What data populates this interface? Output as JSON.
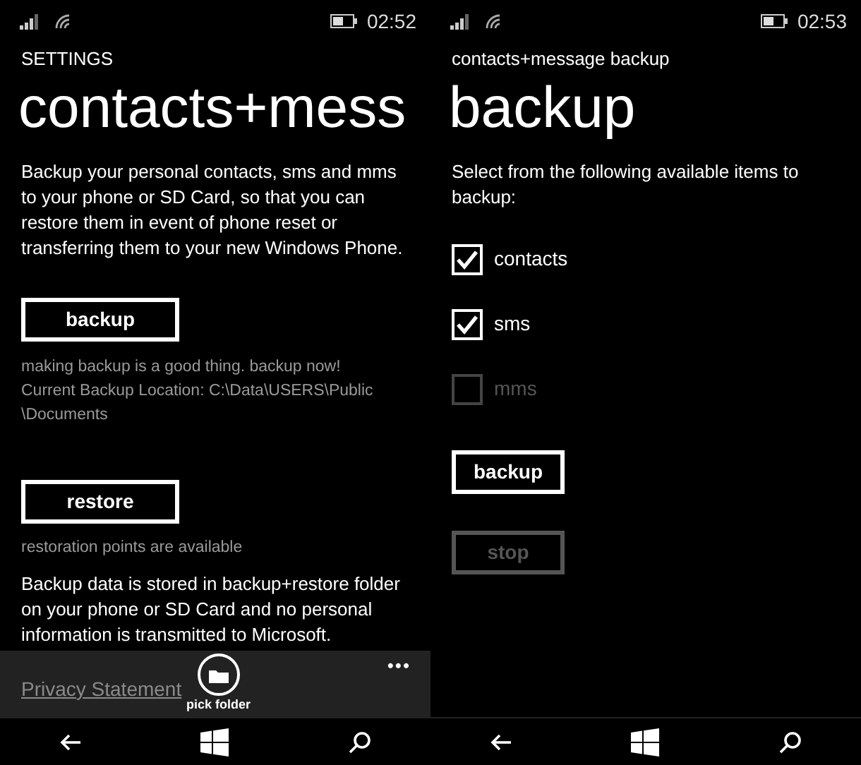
{
  "left_screen": {
    "status_bar": {
      "time": "02:52"
    },
    "header": "SETTINGS",
    "title": "contacts+mess",
    "description": "Backup your personal contacts, sms and mms to your phone or SD Card, so that you can restore them in event of phone reset or transferring them to your new Windows Phone.",
    "backup_button": {
      "label": "backup"
    },
    "backup_notes": [
      "making backup is a good thing. backup now!",
      "Current Backup Location: C:\\Data\\USERS\\Public",
      "\\Documents"
    ],
    "restore_button": {
      "label": "restore"
    },
    "restore_note": "restoration points are available",
    "storage_note": "Backup data is stored in backup+restore folder on your phone or SD Card and no personal information is transmitted to Microsoft.",
    "privacy_link": "Privacy Statement",
    "app_bar": {
      "buttons": [
        {
          "label": "pick folder"
        }
      ],
      "more": "•••"
    }
  },
  "right_screen": {
    "status_bar": {
      "time": "02:53"
    },
    "header": "contacts+message backup",
    "title": "backup",
    "prompt": "Select from the following available items to backup:",
    "items": [
      {
        "label": "contacts",
        "checked": true,
        "disabled": false
      },
      {
        "label": "sms",
        "checked": true,
        "disabled": false
      },
      {
        "label": "mms",
        "checked": false,
        "disabled": true
      }
    ],
    "buttons": [
      {
        "label": "backup",
        "disabled": false
      },
      {
        "label": "stop",
        "disabled": true
      }
    ]
  }
}
